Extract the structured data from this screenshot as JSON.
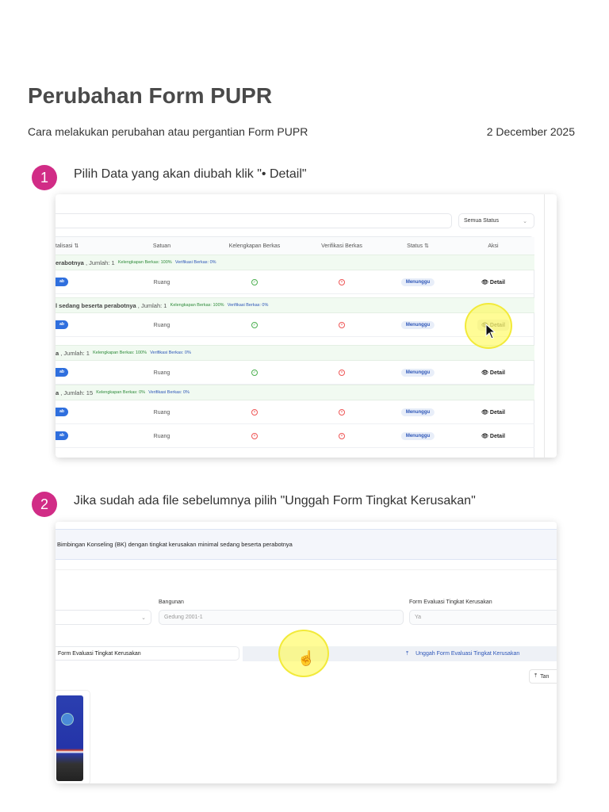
{
  "header": {
    "title": "Perubahan Form PUPR",
    "subtitle": "Cara melakukan perubahan atau pergantian Form PUPR",
    "date": "2 December 2025"
  },
  "steps": [
    {
      "number": "1",
      "text": "Pilih Data yang akan diubah klik \"• Detail\""
    },
    {
      "number": "2",
      "text": "Jika sudah ada file sebelumnya pilih \"Unggah Form Tingkat Kerusakan\""
    }
  ],
  "shot1": {
    "status_filter": "Semua Status",
    "columns": [
      "talisasi ⇅",
      "Satuan",
      "Kelengkapan Berkas",
      "Verifikasi Berkas",
      "Status ⇅",
      "Aksi"
    ],
    "rows": [
      {
        "type": "group",
        "name": "erabotnya",
        "count": ", Jumlah: 1",
        "kelengkapan": "Kelengkapan Berkas: 100%",
        "verifikasi": "Verifikasi Berkas: 0%"
      },
      {
        "type": "data",
        "pill": "ab",
        "satuan": "Ruang",
        "kel": "ok",
        "ver": "bad",
        "status": "Menunggu",
        "aksi": "Detail"
      },
      {
        "type": "group",
        "name": "l sedang beserta perabotnya",
        "count": ", Jumlah: 1",
        "kelengkapan": "Kelengkapan Berkas: 100%",
        "verifikasi": "Verifikasi Berkas: 0%"
      },
      {
        "type": "data",
        "pill": "ab",
        "satuan": "Ruang",
        "kel": "ok",
        "ver": "bad",
        "status": "Menunggu",
        "aksi": "Detail",
        "hover": true
      },
      {
        "type": "group",
        "name": "a",
        "count": ", Jumlah: 1",
        "kelengkapan": "Kelengkapan Berkas: 100%",
        "verifikasi": "Verifikasi Berkas: 0%"
      },
      {
        "type": "data",
        "pill": "ab",
        "satuan": "Ruang",
        "kel": "ok",
        "ver": "bad",
        "status": "Menunggu",
        "aksi": "Detail"
      },
      {
        "type": "group",
        "name": "a",
        "count": ", Jumlah: 15",
        "kelengkapan": "Kelengkapan Berkas: 0%",
        "verifikasi": "Verifikasi Berkas: 0%"
      },
      {
        "type": "data",
        "pill": "ab",
        "satuan": "Ruang",
        "kel": "bad",
        "ver": "bad",
        "status": "Menunggu",
        "aksi": "Detail"
      },
      {
        "type": "data",
        "pill": "ab",
        "satuan": "Ruang",
        "kel": "bad",
        "ver": "bad",
        "status": "Menunggu",
        "aksi": "Detail"
      }
    ]
  },
  "shot2": {
    "banner": "Bimbingan Konseling (BK) dengan tingkat kerusakan minimal sedang beserta perabotnya",
    "bangunan_label": "Bangunan",
    "bangunan_value": "Gedung 2001-1",
    "form_label": "Form Evaluasi Tingkat Kerusakan",
    "form_value": "Ya",
    "file_label": "Form Evaluasi Tingkat Kerusakan",
    "upload_button": "Unggah Form Evaluasi Tingkat Kerusakan",
    "add_button": "Tan"
  },
  "colors": {
    "accent": "#d12c86",
    "primary": "#2f6fde"
  }
}
